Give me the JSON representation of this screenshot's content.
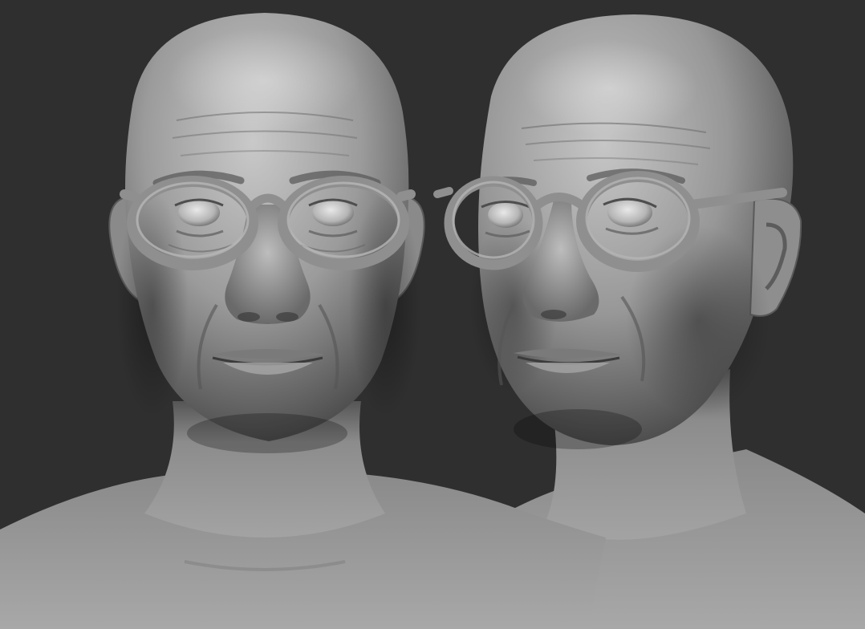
{
  "scene": {
    "background_color": "#2f2f2f",
    "clay_color": "#9a9a9a",
    "clay_light": "#c4c4c4",
    "clay_dark": "#4a4a4a",
    "glasses_color": "#8f8f8f",
    "views": [
      {
        "name": "front-view",
        "subject": "bald-male-bust-with-round-glasses"
      },
      {
        "name": "three-quarter-view",
        "subject": "bald-male-bust-with-round-glasses"
      }
    ]
  }
}
